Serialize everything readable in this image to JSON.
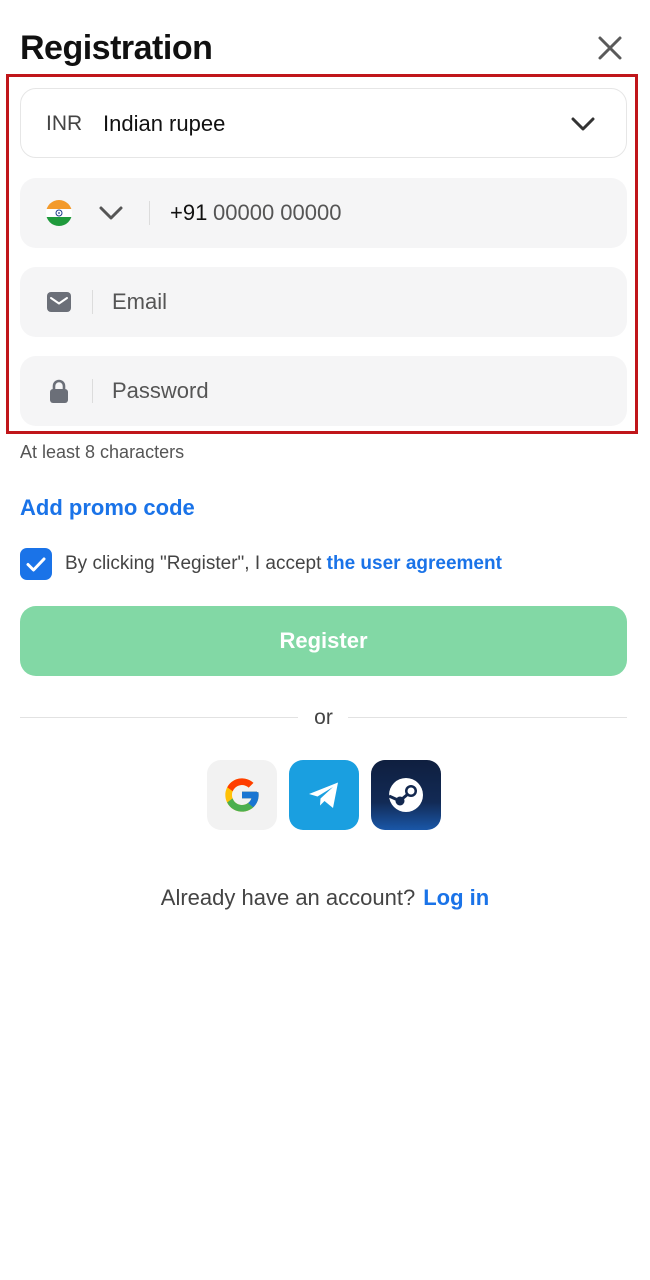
{
  "header": {
    "title": "Registration"
  },
  "currency": {
    "code": "INR",
    "name": "Indian rupee"
  },
  "phone": {
    "country_prefix": "+91",
    "placeholder": "00000 00000",
    "value": ""
  },
  "email": {
    "placeholder": "Email",
    "value": ""
  },
  "password": {
    "placeholder": "Password",
    "value": "",
    "hint": "At least 8 characters"
  },
  "promo": {
    "label": "Add promo code"
  },
  "agreement": {
    "checked": true,
    "text": "By clicking \"Register\", I accept ",
    "link": "the user agreement"
  },
  "register": {
    "label": "Register"
  },
  "divider": {
    "text": "or"
  },
  "social": {
    "providers": [
      "google-icon",
      "telegram-icon",
      "steam-icon"
    ]
  },
  "login": {
    "prompt": "Already have an account?",
    "link": "Log in"
  },
  "colors": {
    "accent": "#1a73e8",
    "register_bg": "#82d8a5",
    "highlight_border": "#c0161a",
    "field_bg": "#f5f5f6"
  }
}
